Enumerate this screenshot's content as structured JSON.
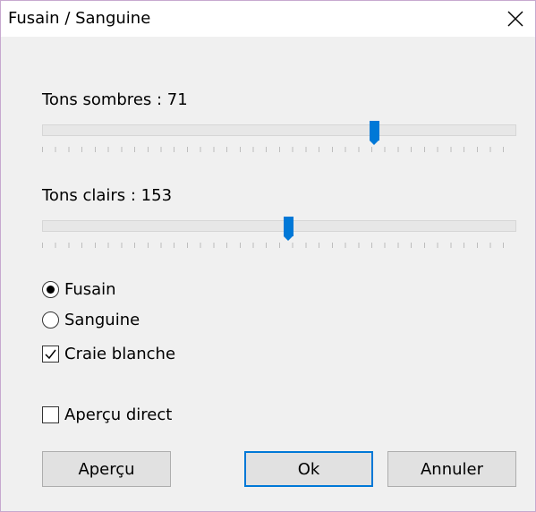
{
  "window": {
    "title": "Fusain / Sanguine"
  },
  "sliders": [
    {
      "label": "Tons sombres : 71",
      "value": 71,
      "fraction": 0.7
    },
    {
      "label": "Tons clairs : 153",
      "value": 153,
      "fraction": 0.52
    }
  ],
  "options": {
    "radio_fusain": {
      "label": "Fusain",
      "checked": true
    },
    "radio_sanguine": {
      "label": "Sanguine",
      "checked": false
    },
    "check_craie": {
      "label": "Craie blanche",
      "checked": true
    },
    "check_apercu_direct": {
      "label": "Aperçu direct",
      "checked": false
    }
  },
  "buttons": {
    "preview": "Aperçu",
    "ok": "Ok",
    "cancel": "Annuler"
  },
  "colors": {
    "accent": "#0078d7",
    "window_border": "#c7a9cf",
    "dialog_bg": "#f0f0f0"
  }
}
